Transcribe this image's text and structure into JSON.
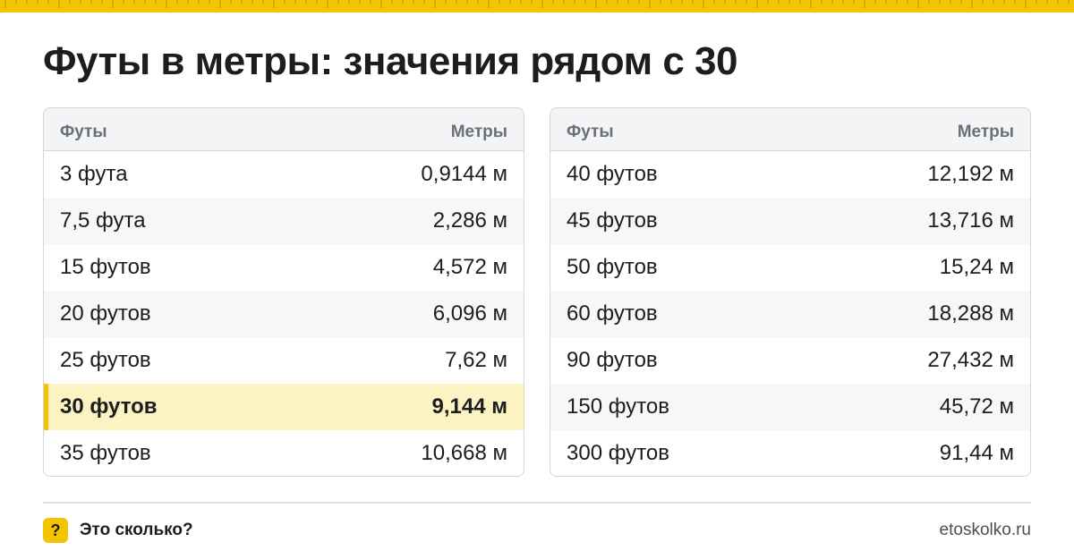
{
  "title": "Футы в метры: значения рядом с 30",
  "colors": {
    "accent": "#f5c400",
    "highlight_row": "#fdf3c2",
    "header_bg": "#f3f4f6",
    "border": "#d3d5d9"
  },
  "tables": [
    {
      "headers": {
        "feet": "Футы",
        "meters": "Метры"
      },
      "rows": [
        {
          "feet": "3 фута",
          "meters": "0,9144 м",
          "highlighted": false
        },
        {
          "feet": "7,5 фута",
          "meters": "2,286 м",
          "highlighted": false
        },
        {
          "feet": "15 футов",
          "meters": "4,572 м",
          "highlighted": false
        },
        {
          "feet": "20 футов",
          "meters": "6,096 м",
          "highlighted": false
        },
        {
          "feet": "25 футов",
          "meters": "7,62 м",
          "highlighted": false
        },
        {
          "feet": "30 футов",
          "meters": "9,144 м",
          "highlighted": true
        },
        {
          "feet": "35 футов",
          "meters": "10,668 м",
          "highlighted": false
        }
      ]
    },
    {
      "headers": {
        "feet": "Футы",
        "meters": "Метры"
      },
      "rows": [
        {
          "feet": "40 футов",
          "meters": "12,192 м",
          "highlighted": false
        },
        {
          "feet": "45 футов",
          "meters": "13,716 м",
          "highlighted": false
        },
        {
          "feet": "50 футов",
          "meters": "15,24 м",
          "highlighted": false
        },
        {
          "feet": "60 футов",
          "meters": "18,288 м",
          "highlighted": false
        },
        {
          "feet": "90 футов",
          "meters": "27,432 м",
          "highlighted": false
        },
        {
          "feet": "150 футов",
          "meters": "45,72 м",
          "highlighted": false
        },
        {
          "feet": "300 футов",
          "meters": "91,44 м",
          "highlighted": false
        }
      ]
    }
  ],
  "footer": {
    "badge_icon": "question-mark-icon",
    "badge_symbol": "?",
    "brand_name": "Это сколько?",
    "site": "etoskolko.ru"
  }
}
